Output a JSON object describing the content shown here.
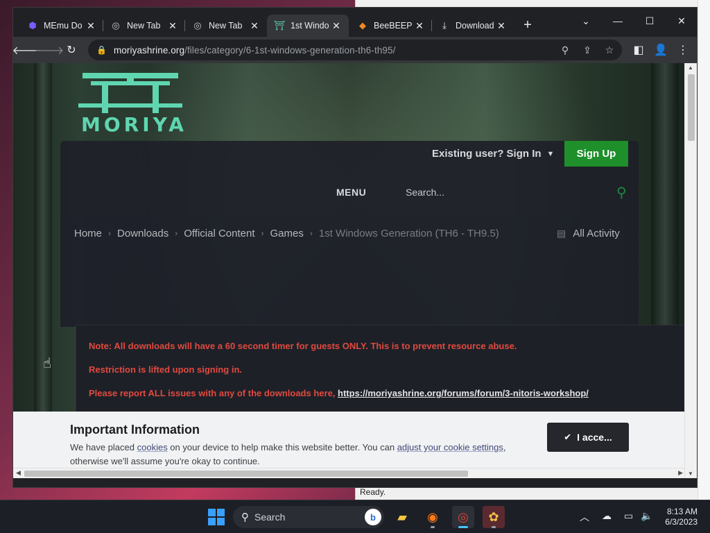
{
  "browser": {
    "tabs": [
      {
        "title": "MEmu Do",
        "icon": "memu-icon"
      },
      {
        "title": "New Tab",
        "icon": "chrome-icon"
      },
      {
        "title": "New Tab",
        "icon": "chrome-icon"
      },
      {
        "title": "1st Windo",
        "icon": "moriya-icon",
        "active": true
      },
      {
        "title": "BeeBEEP (",
        "icon": "beebeep-icon"
      },
      {
        "title": "Download",
        "icon": "download-icon"
      }
    ],
    "url_host": "moriyashrine.org",
    "url_path": "/files/category/6-1st-windows-generation-th6-th95/"
  },
  "site": {
    "logo_text": "MORIYA",
    "signin_label": "Existing user? Sign In",
    "signup_label": "Sign Up",
    "menu_label": "MENU",
    "search_placeholder": "Search...",
    "breadcrumb": [
      "Home",
      "Downloads",
      "Official Content",
      "Games",
      "1st Windows Generation (TH6 - TH9.5)"
    ],
    "activity_label": "All Activity",
    "notice": {
      "line1": "Note: All downloads will have a 60 second timer for guests ONLY. This is to prevent resource abuse.",
      "line2": "Restriction is lifted upon signing in.",
      "line3_prefix": "Please report ALL issues with any of the downloads here, ",
      "line3_link": "https://moriyashrine.org/forums/forum/3-nitoris-workshop/"
    },
    "cookie": {
      "title": "Important Information",
      "text_1": "We have placed ",
      "link_1": "cookies",
      "text_2": " on your device to help make this website better. You can ",
      "link_2": "adjust your cookie settings",
      "text_3": ", otherwise we'll assume you're okay to continue.",
      "accept_label": "I acce..."
    }
  },
  "background_window": {
    "status_text": "Ready."
  },
  "taskbar": {
    "search_label": "Search",
    "time": "8:13 AM",
    "date": "6/3/2023"
  },
  "colors": {
    "signup_green": "#1e8f2a",
    "notice_red": "#e04a3e",
    "logo_teal": "#5fd6b0"
  }
}
